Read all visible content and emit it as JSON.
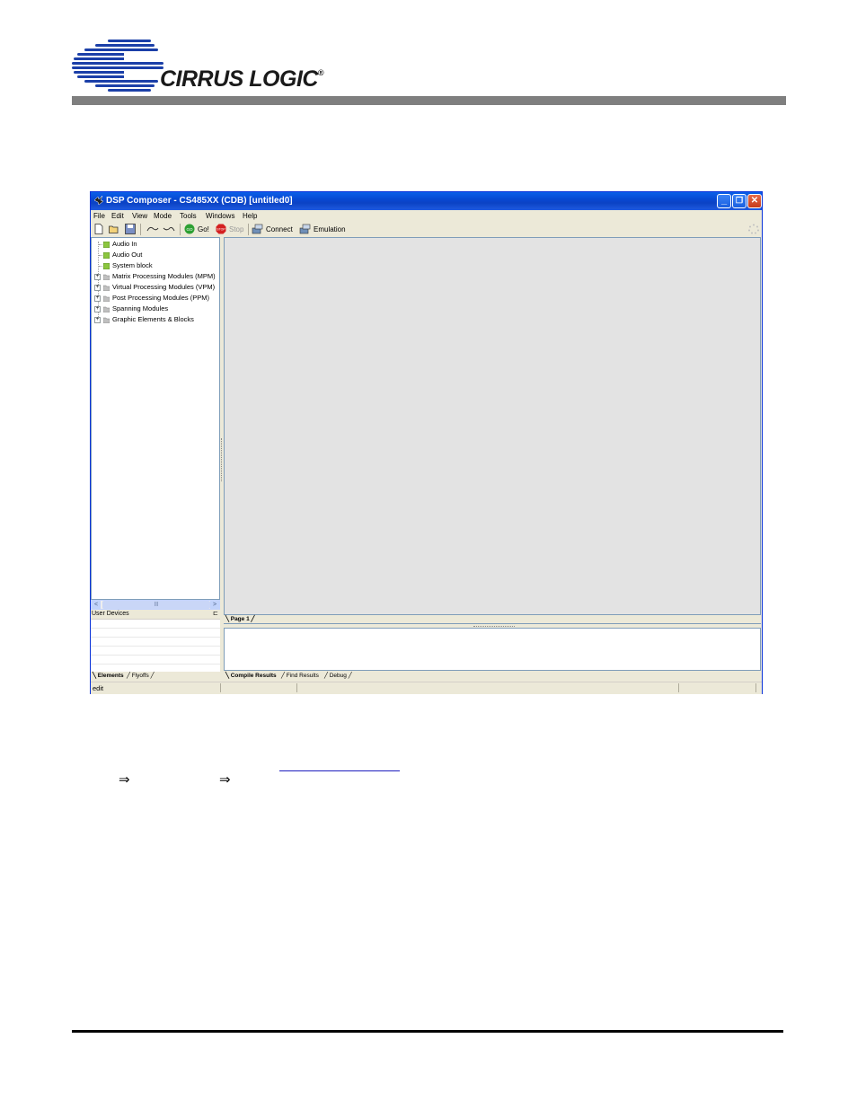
{
  "logo": {
    "text": "CIRRUS LOGIC",
    "registered": "®"
  },
  "window": {
    "title": "DSP Composer - CS485XX (CDB) [untitled0]",
    "controls": {
      "minimize": "_",
      "maximize": "❐",
      "close": "✕"
    }
  },
  "menu": [
    "File",
    "Edit",
    "View",
    "Mode",
    "Tools",
    "Windows",
    "Help"
  ],
  "toolbar": {
    "go": "Go!",
    "stop": "Stop",
    "connect": "Connect",
    "emulation": "Emulation",
    "go_icon_text": "GO",
    "stop_icon_text": "STOP"
  },
  "tree": {
    "items": [
      "Audio In",
      "Audio Out",
      "System block",
      "Matrix Processing Modules (MPM)",
      "Virtual Processing Modules (VPM)",
      "Post Processing Modules (PPM)",
      "Spanning Modules",
      "Graphic Elements & Blocks"
    ]
  },
  "scroll": {
    "left": "<",
    "right": ">",
    "mid": "|||"
  },
  "user_devices": {
    "label": "User Devices",
    "pin": "⊏"
  },
  "left_tabs": [
    "Elements",
    "Flyoffs"
  ],
  "page_tabs": [
    "Page 1"
  ],
  "output_tabs": [
    "Compile Results",
    "Find Results",
    "Debug"
  ],
  "status": {
    "mode": "edit"
  },
  "colors": {
    "titlebar": "#0846cf",
    "canvas": "#e3e3e3",
    "go_icon": "#2da033",
    "stop_icon": "#d42020",
    "header_bar": "#7f7f7f",
    "logo_blue": "#1b3fa8"
  },
  "doc": {
    "arrow1": "⇒",
    "arrow2": "⇒"
  }
}
